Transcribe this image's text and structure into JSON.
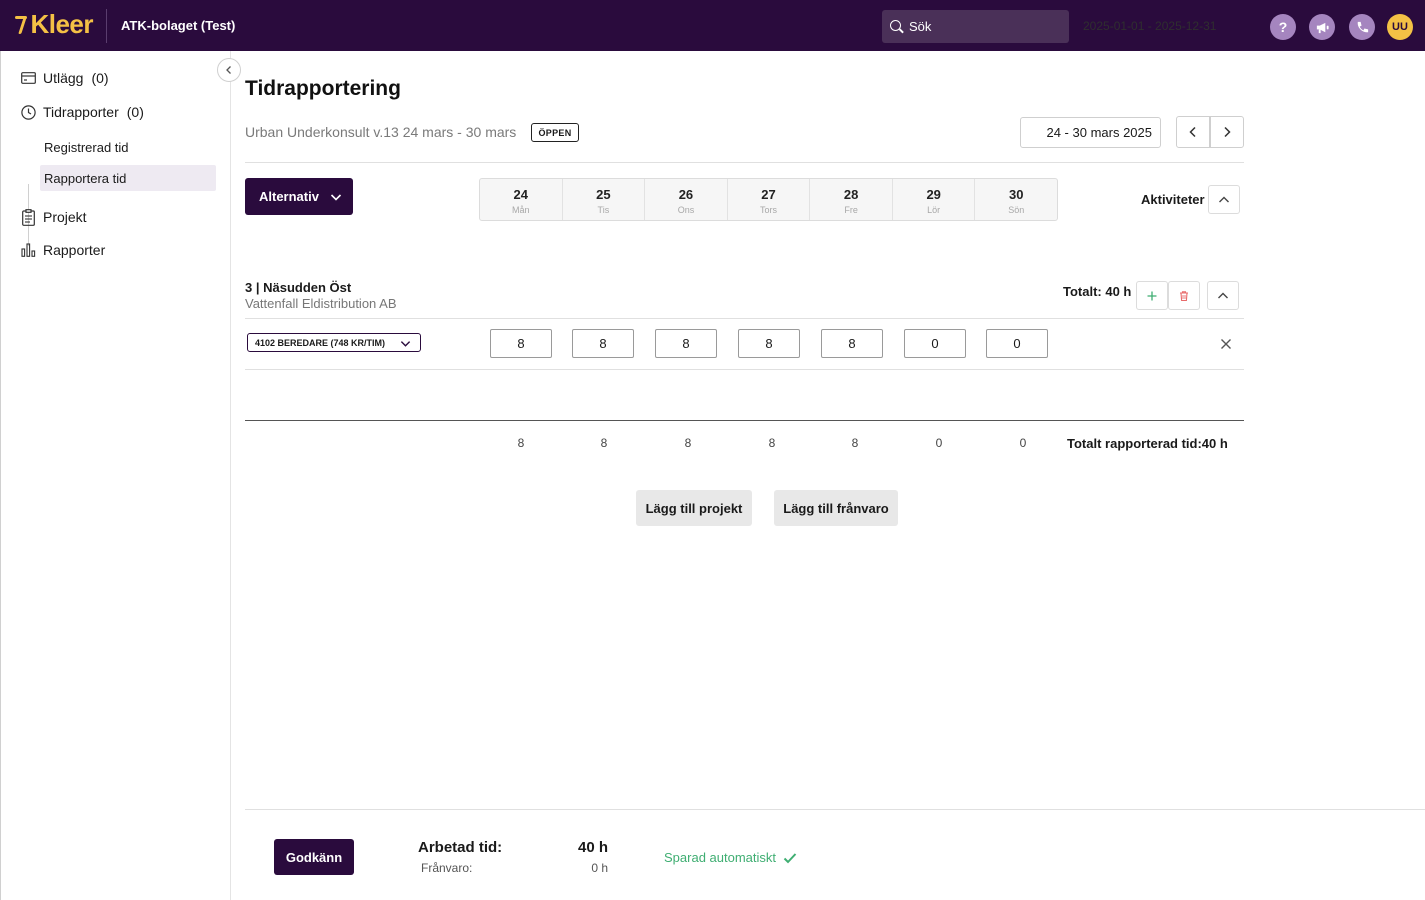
{
  "topbar": {
    "logo": "Kleer",
    "company": "ATK-bolaget (Test)",
    "search_placeholder": "Sök",
    "period": "2025-01-01 - 2025-12-31",
    "help_label": "?",
    "avatar_initials": "UU",
    "icons": [
      "help-icon",
      "megaphone-icon",
      "phone-icon"
    ]
  },
  "sidebar": {
    "items": [
      {
        "label": "Utlägg",
        "count": "(0)",
        "icon": "receipt-icon"
      },
      {
        "label": "Tidrapporter",
        "count": "(0)",
        "icon": "clock-icon"
      },
      {
        "label": "Projekt",
        "icon": "clipboard-icon"
      },
      {
        "label": "Rapporter",
        "icon": "bar-chart-icon"
      }
    ],
    "sub_items": [
      {
        "label": "Registrerad tid",
        "active": false
      },
      {
        "label": "Rapportera tid",
        "active": true
      }
    ]
  },
  "main": {
    "title": "Tidrapportering",
    "subtitle": "Urban Underkonsult v.13 24 mars - 30 mars",
    "status_badge": "ÖPPEN",
    "date_range": "24 - 30 mars 2025",
    "options_button": "Alternativ",
    "days": [
      {
        "num": "24",
        "name": "Mån"
      },
      {
        "num": "25",
        "name": "Tis"
      },
      {
        "num": "26",
        "name": "Ons"
      },
      {
        "num": "27",
        "name": "Tors"
      },
      {
        "num": "28",
        "name": "Fre"
      },
      {
        "num": "29",
        "name": "Lör"
      },
      {
        "num": "30",
        "name": "Sön"
      }
    ],
    "activities_label": "Aktiviteter",
    "project": {
      "name": "3 | Näsudden Öst",
      "client": "Vattenfall Eldistribution AB",
      "total": "Totalt: 40 h",
      "activity": "4102 BEREDARE (748 KR/TIM)",
      "hours": [
        "8",
        "8",
        "8",
        "8",
        "8",
        "0",
        "0"
      ]
    },
    "day_sums": [
      "8",
      "8",
      "8",
      "8",
      "8",
      "0",
      "0"
    ],
    "total_reported": "Totalt rapporterad tid:40 h",
    "add_project_button": "Lägg till projekt",
    "add_absence_button": "Lägg till frånvaro"
  },
  "footer": {
    "approve_button": "Godkänn",
    "worked_label": "Arbetad tid:",
    "worked_value": "40 h",
    "absence_label": "Frånvaro:",
    "absence_value": "0 h",
    "saved_status": "Sparad automatiskt"
  },
  "colors": {
    "brand_dark": "#2a0b3d",
    "logo_yellow": "#f4c145",
    "success_green": "#3fae72",
    "delete_red": "#e86a6a"
  }
}
